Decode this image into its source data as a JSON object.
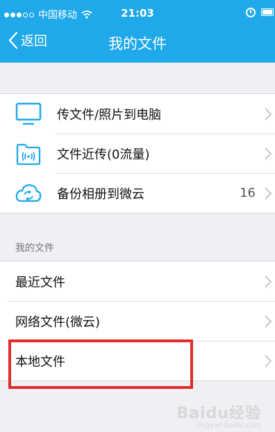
{
  "status_bar": {
    "carrier": "中国移动",
    "time": "21:03",
    "wifi_icon": "wifi-icon",
    "alarm_icon": "alarm-icon",
    "battery_icon": "battery-icon"
  },
  "nav": {
    "back_label": "返回",
    "title": "我的文件"
  },
  "group1": {
    "items": [
      {
        "label": "传文件/照片到电脑",
        "icon": "monitor-icon"
      },
      {
        "label": "文件近传(0流量)",
        "icon": "wireless-folder-icon"
      },
      {
        "label": "备份相册到微云",
        "icon": "cloud-sync-icon",
        "count": "16"
      }
    ]
  },
  "section_title": "我的文件",
  "group2": {
    "items": [
      {
        "label": "最近文件"
      },
      {
        "label": "网络文件(微云)"
      },
      {
        "label": "本地文件"
      }
    ]
  },
  "watermark": {
    "logo": "Baidu经验",
    "sub": "jingyan.baidu.com"
  },
  "colors": {
    "header": "#1fa8ea",
    "highlight": "#e32b2b",
    "icon": "#1fa8ea"
  }
}
